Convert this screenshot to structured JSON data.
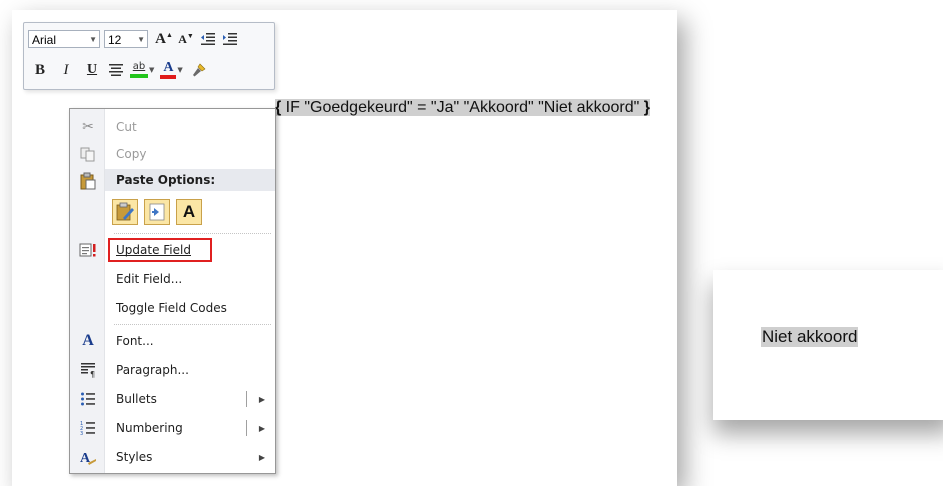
{
  "toolbar": {
    "font_name": "Arial",
    "font_size": "12",
    "bold": "B",
    "italic": "I",
    "underline": "U",
    "grow_font": "A",
    "shrink_font": "A",
    "font_color_letter": "A",
    "highlight_letters": "ab",
    "highlight_color": "#22c51c",
    "font_color": "#e01b1b"
  },
  "field_code": {
    "open_brace": "{",
    "text": " IF \"Goedgekeurd\" = \"Ja\" \"Akkoord\" \"Niet akkoord\" ",
    "close_brace": "}"
  },
  "menu": {
    "cut": "Cut",
    "copy": "Copy",
    "paste_options": "Paste Options:",
    "paste_text_only": "A",
    "update_field": "Update Field",
    "edit_field": "Edit Field...",
    "toggle_field_codes": "Toggle Field Codes",
    "font": "Font...",
    "paragraph": "Paragraph...",
    "bullets": "Bullets",
    "numbering": "Numbering",
    "styles": "Styles",
    "font_icon_letter": "A"
  },
  "result": {
    "text": "Niet akkoord"
  }
}
